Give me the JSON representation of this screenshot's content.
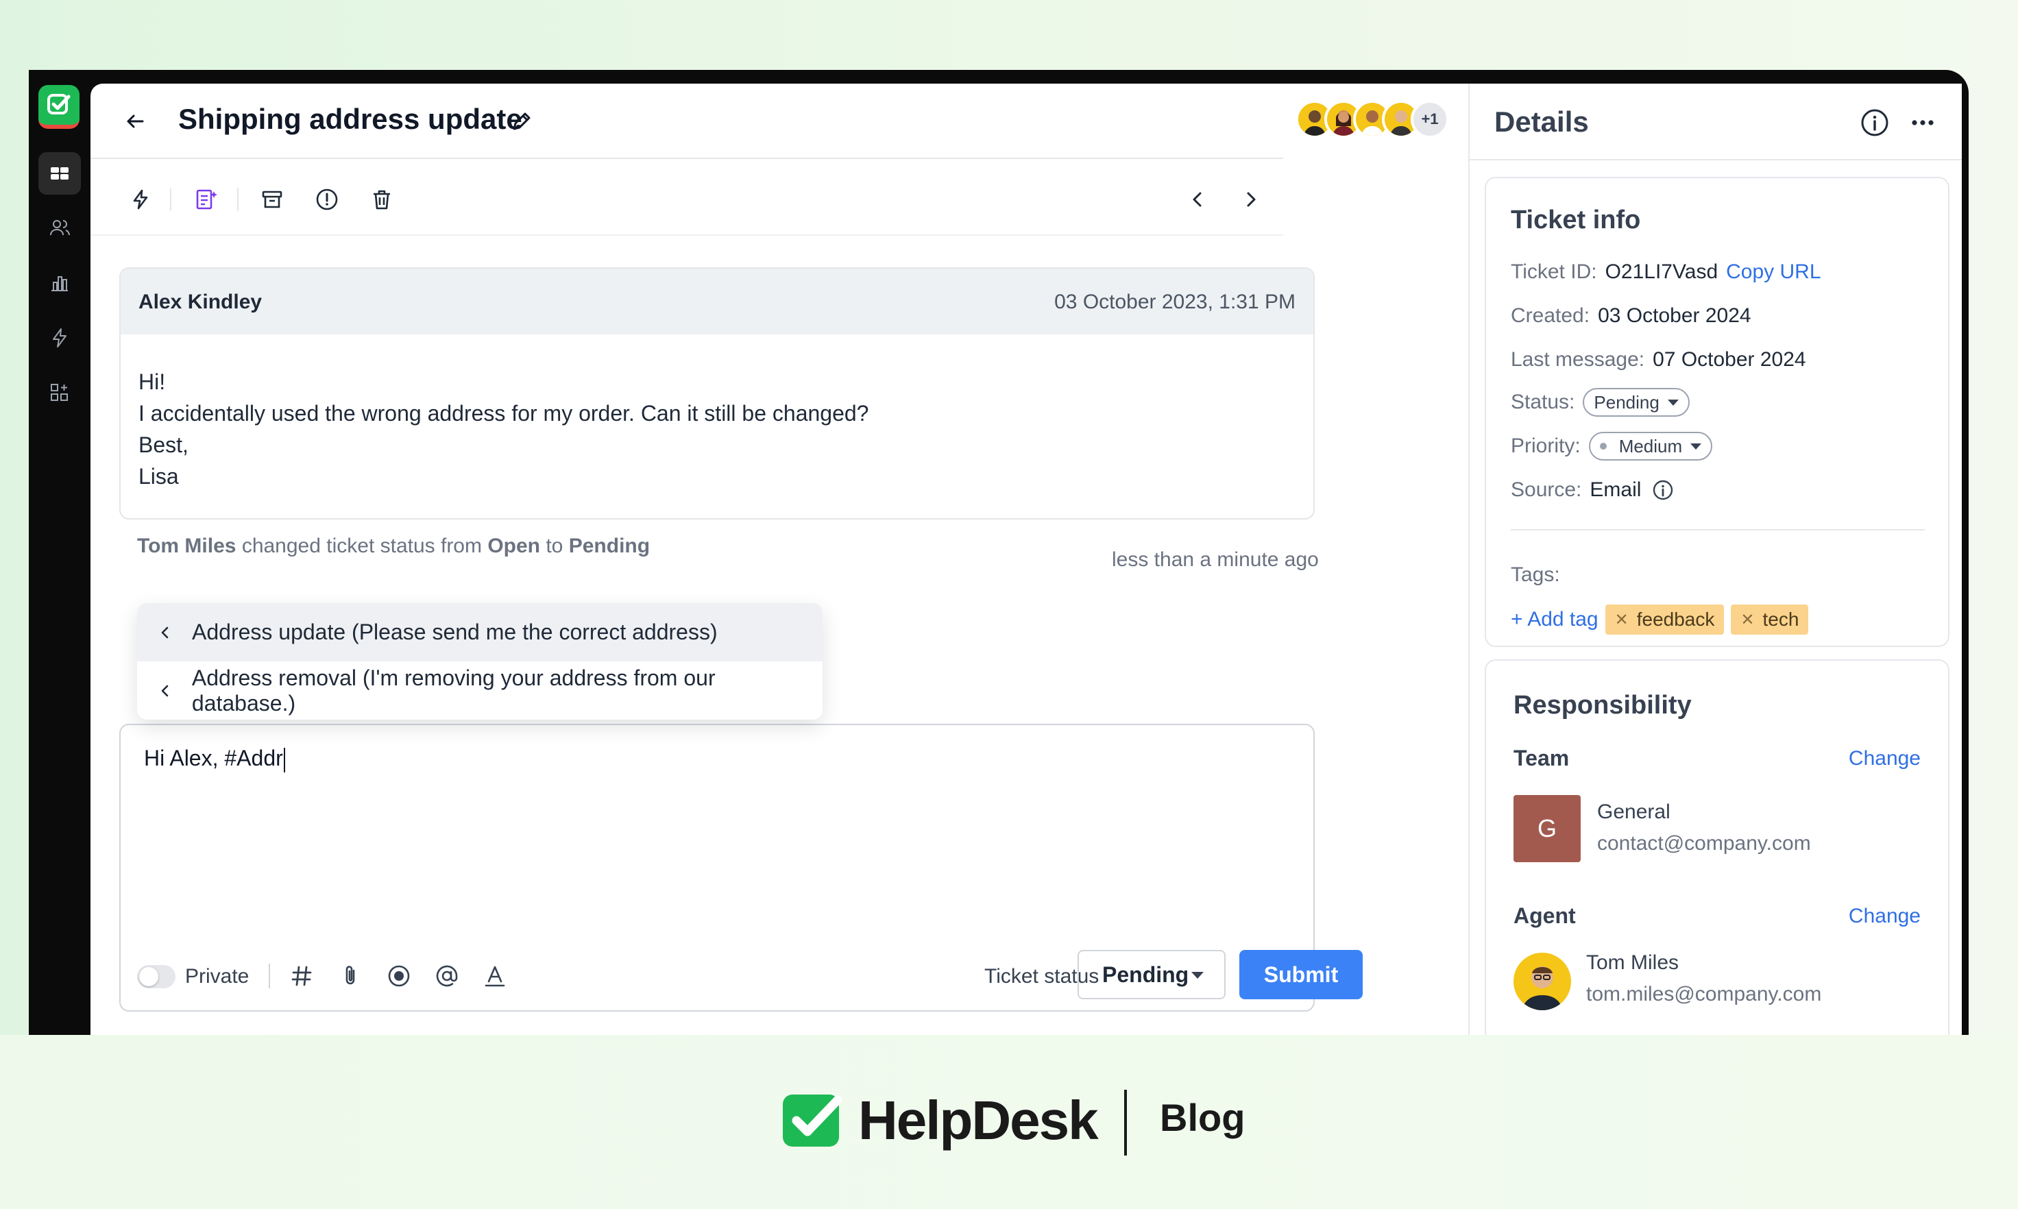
{
  "ticket": {
    "title": "Shipping address update",
    "more_assignees": "+1"
  },
  "message": {
    "author": "Alex Kindley",
    "date": "03 October 2023, 1:31 PM",
    "lines": [
      "Hi!",
      "I accidentally used the wrong address for my order. Can it still be changed?",
      "Best,",
      "Lisa"
    ]
  },
  "activity": {
    "actor": "Tom Miles",
    "text": "changed ticket status from",
    "from": "Open",
    "to_word": "to",
    "to": "Pending",
    "time": "less than a minute ago"
  },
  "suggestions": [
    "Address update (Please send me the correct address)",
    "Address removal (I'm removing your address from our database.)"
  ],
  "composer": {
    "text": "Hi Alex, #Addr",
    "private_label": "Private",
    "ticket_status_label": "Ticket status",
    "ticket_status_value": "Pending",
    "submit_label": "Submit"
  },
  "details": {
    "title": "Details",
    "ticket_info": {
      "heading": "Ticket info",
      "ticket_id_label": "Ticket ID:",
      "ticket_id": "O21LI7Vasd",
      "copy_url": "Copy URL",
      "created_label": "Created:",
      "created": "03 October 2024",
      "last_message_label": "Last message:",
      "last_message": "07 October 2024",
      "status_label": "Status:",
      "status": "Pending",
      "priority_label": "Priority:",
      "priority": "Medium",
      "source_label": "Source:",
      "source": "Email",
      "tags_label": "Tags:",
      "add_tag": "+ Add tag",
      "tags": [
        "feedback",
        "tech"
      ]
    },
    "responsibility": {
      "heading": "Responsibility",
      "team_label": "Team",
      "change_label": "Change",
      "team_initial": "G",
      "team_name": "General",
      "team_email": "contact@company.com",
      "agent_label": "Agent",
      "agent_name": "Tom Miles",
      "agent_email": "tom.miles@company.com"
    }
  },
  "brand": {
    "name": "HelpDesk",
    "section": "Blog"
  },
  "colors": {
    "accent_blue": "#3b82f6",
    "brand_green": "#1db954",
    "tag_bg": "#fbd38d"
  }
}
